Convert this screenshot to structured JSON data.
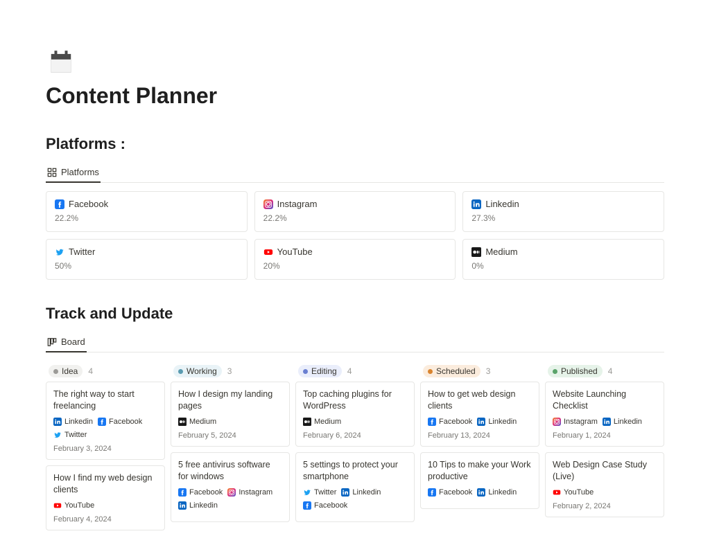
{
  "page": {
    "title": "Content Planner"
  },
  "platforms_section": {
    "heading": "Platforms :",
    "tab_label": "Platforms",
    "items": [
      {
        "icon": "facebook",
        "name": "Facebook",
        "pct": "22.2%"
      },
      {
        "icon": "instagram",
        "name": "Instagram",
        "pct": "22.2%"
      },
      {
        "icon": "linkedin",
        "name": "Linkedin",
        "pct": "27.3%"
      },
      {
        "icon": "twitter",
        "name": "Twitter",
        "pct": "50%"
      },
      {
        "icon": "youtube",
        "name": "YouTube",
        "pct": "20%"
      },
      {
        "icon": "medium",
        "name": "Medium",
        "pct": "0%"
      }
    ]
  },
  "board_section": {
    "heading": "Track and Update",
    "tab_label": "Board",
    "columns": [
      {
        "status": "Idea",
        "count": "4",
        "bg": "#f1f1ef",
        "dot": "#9b9a97",
        "cards": [
          {
            "title": "The right way to start freelancing",
            "date": "February 3, 2024",
            "tags": [
              {
                "icon": "linkedin",
                "label": "Linkedin"
              },
              {
                "icon": "facebook",
                "label": "Facebook"
              },
              {
                "icon": "twitter",
                "label": "Twitter"
              }
            ]
          },
          {
            "title": "How I find my web design clients",
            "date": "February 4, 2024",
            "tags": [
              {
                "icon": "youtube",
                "label": "YouTube"
              }
            ]
          }
        ]
      },
      {
        "status": "Working",
        "count": "3",
        "bg": "#e9f3f7",
        "dot": "#5a9bb0",
        "cards": [
          {
            "title": "How I design my landing pages",
            "date": "February 5, 2024",
            "tags": [
              {
                "icon": "medium",
                "label": "Medium"
              }
            ]
          },
          {
            "title": "5 free antivirus software for windows",
            "date": "",
            "tags": [
              {
                "icon": "facebook",
                "label": "Facebook"
              },
              {
                "icon": "instagram",
                "label": "Instagram"
              },
              {
                "icon": "linkedin",
                "label": "Linkedin"
              }
            ]
          }
        ]
      },
      {
        "status": "Editing",
        "count": "4",
        "bg": "#eaeefb",
        "dot": "#6a7fd1",
        "cards": [
          {
            "title": "Top caching plugins for WordPress",
            "date": "February 6, 2024",
            "tags": [
              {
                "icon": "medium",
                "label": "Medium"
              }
            ]
          },
          {
            "title": "5 settings to protect your smartphone",
            "date": "",
            "tags": [
              {
                "icon": "twitter",
                "label": "Twitter"
              },
              {
                "icon": "linkedin",
                "label": "Linkedin"
              },
              {
                "icon": "facebook",
                "label": "Facebook"
              }
            ]
          }
        ]
      },
      {
        "status": "Scheduled",
        "count": "3",
        "bg": "#fbecdd",
        "dot": "#d9842f",
        "cards": [
          {
            "title": "How to get web design clients",
            "date": "February 13, 2024",
            "tags": [
              {
                "icon": "facebook",
                "label": "Facebook"
              },
              {
                "icon": "linkedin",
                "label": "Linkedin"
              }
            ]
          },
          {
            "title": "10 Tips to make your Work productive",
            "date": "",
            "tags": [
              {
                "icon": "facebook",
                "label": "Facebook"
              },
              {
                "icon": "linkedin",
                "label": "Linkedin"
              }
            ]
          }
        ]
      },
      {
        "status": "Published",
        "count": "4",
        "bg": "#e6f3e9",
        "dot": "#5aa36a",
        "cards": [
          {
            "title": "Website Launching Checklist",
            "date": "February 1, 2024",
            "tags": [
              {
                "icon": "instagram",
                "label": "Instagram"
              },
              {
                "icon": "linkedin",
                "label": "Linkedin"
              }
            ]
          },
          {
            "title": "Web Design Case Study (Live)",
            "date": "February 2, 2024",
            "tags": [
              {
                "icon": "youtube",
                "label": "YouTube"
              }
            ]
          }
        ]
      }
    ]
  },
  "icons": {
    "facebook": {
      "color": "#1877f2"
    },
    "instagram": {
      "color": "#e1306c"
    },
    "linkedin": {
      "color": "#0a66c2"
    },
    "twitter": {
      "color": "#1da1f2"
    },
    "youtube": {
      "color": "#ff0000"
    },
    "medium": {
      "color": "#191919"
    }
  }
}
